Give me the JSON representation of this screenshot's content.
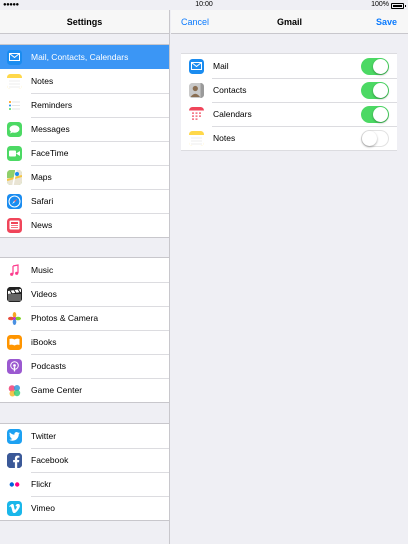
{
  "status_bar": {
    "signal": "●●●●●",
    "time": "10:00",
    "battery": "100%"
  },
  "settings": {
    "title": "Settings",
    "groups": [
      {
        "items": [
          {
            "label": "Mail, Contacts, Calendars",
            "icon": "mail-icon",
            "color": "#1a8cf0",
            "selected": true
          },
          {
            "label": "Notes",
            "icon": "notes-icon",
            "color": "#ffd84a"
          },
          {
            "label": "Reminders",
            "icon": "reminders-icon",
            "color": "#ffffff"
          },
          {
            "label": "Messages",
            "icon": "messages-icon",
            "color": "#4cd964"
          },
          {
            "label": "FaceTime",
            "icon": "facetime-icon",
            "color": "#4cd964"
          },
          {
            "label": "Maps",
            "icon": "maps-icon",
            "color": "#8fcf6a"
          },
          {
            "label": "Safari",
            "icon": "safari-icon",
            "color": "#1a8cf0"
          },
          {
            "label": "News",
            "icon": "news-icon",
            "color": "#f0455a"
          }
        ]
      },
      {
        "items": [
          {
            "label": "Music",
            "icon": "music-icon",
            "color": "#ffffff"
          },
          {
            "label": "Videos",
            "icon": "videos-icon",
            "color": "#222222"
          },
          {
            "label": "Photos & Camera",
            "icon": "photos-icon",
            "color": "#ffffff"
          },
          {
            "label": "iBooks",
            "icon": "ibooks-icon",
            "color": "#ff9500"
          },
          {
            "label": "Podcasts",
            "icon": "podcasts-icon",
            "color": "#9b59d0"
          },
          {
            "label": "Game Center",
            "icon": "game-center-icon",
            "color": "#ffffff"
          }
        ]
      },
      {
        "items": [
          {
            "label": "Twitter",
            "icon": "twitter-icon",
            "color": "#1da1f2"
          },
          {
            "label": "Facebook",
            "icon": "facebook-icon",
            "color": "#3b5998"
          },
          {
            "label": "Flickr",
            "icon": "flickr-icon",
            "color": "#ffffff"
          },
          {
            "label": "Vimeo",
            "icon": "vimeo-icon",
            "color": "#1ab7ea"
          }
        ]
      }
    ]
  },
  "account": {
    "cancel_label": "Cancel",
    "title": "Gmail",
    "save_label": "Save",
    "items": [
      {
        "label": "Mail",
        "icon": "mail-icon",
        "enabled": true
      },
      {
        "label": "Contacts",
        "icon": "contacts-icon",
        "enabled": true
      },
      {
        "label": "Calendars",
        "icon": "calendars-icon",
        "enabled": true
      },
      {
        "label": "Notes",
        "icon": "notes-icon",
        "enabled": false
      }
    ]
  },
  "colors": {
    "accent": "#0a7afe",
    "selected_row": "#3b96f5",
    "toggle_on": "#4cd964"
  }
}
